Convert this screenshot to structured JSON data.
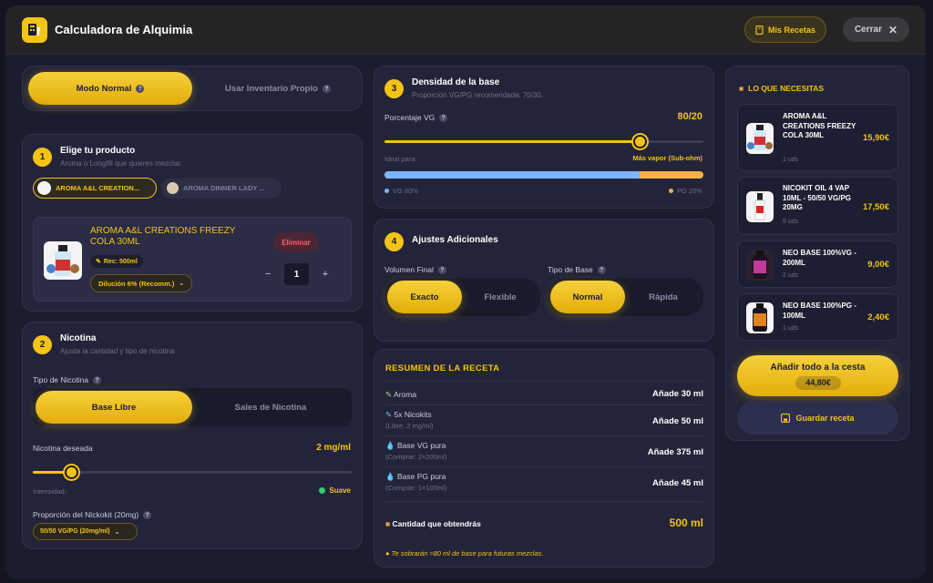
{
  "app": {
    "title": "Calculadora de Alquimia",
    "mis_recetas": "Mis Recetas",
    "cerrar": "Cerrar",
    "accent": "#f3c316"
  },
  "mode": {
    "normal": "Modo Normal",
    "inventory": "Usar Inventario Propio"
  },
  "product": {
    "step": "1",
    "title": "Elige tu producto",
    "subtitle": "Aroma o Longfill que quieres mezclar.",
    "chips": [
      "AROMA A&L CREATION...",
      "AROMA DINNER LADY ..."
    ],
    "selected_name": "AROMA A&L CREATIONS FREEZY COLA 30ML",
    "rec": "Rec: 500ml",
    "dilution": "Dilución 6% (Recomm.)",
    "remove": "Eliminar",
    "qty": "1",
    "minus": "−",
    "plus": "+"
  },
  "nicotine": {
    "step": "2",
    "title": "Nicotina",
    "subtitle": "Ajusta la cantidad y tipo de nicotina",
    "type_label": "Tipo de Nicotina",
    "base_libre": "Base Libre",
    "sales": "Sales de Nicotina",
    "desired_label": "Nicotina deseada",
    "desired_value": "2 mg/ml",
    "slider_fraction": 0.12,
    "intensity_label": "Intensidad:",
    "intensity_value": "Suave",
    "prop_label": "Proporción del Nickokit (20mg)",
    "prop_value": "50/50 VG/PG (20mg/ml)"
  },
  "density": {
    "step": "3",
    "title": "Densidad de la base",
    "subtitle": "Proporción VG/PG recomendada: 70/30.",
    "vg_label": "Porcentaje VG",
    "vg_value": "80/20",
    "vg_fraction": 0.8,
    "ideal_label": "Ideal para:",
    "ideal_value": "Más vapor (Sub-ohm)",
    "vg_legend": "VG 80%",
    "pg_legend": "PG 20%"
  },
  "adjust": {
    "step": "4",
    "title": "Ajustes Adicionales",
    "volume_label": "Volumen Final",
    "exact": "Exacto",
    "flexible": "Flexible",
    "base_label": "Tipo de Base",
    "normal": "Normal",
    "rapida": "Rápida"
  },
  "summary": {
    "title": "RESUMEN DE LA RECETA",
    "rows": [
      {
        "label": "Aroma",
        "sub": "",
        "value": "Añade 30 ml"
      },
      {
        "label": "5x Nicokits",
        "sub": "(Libre, 2 mg/ml)",
        "value": "Añade 50 ml"
      },
      {
        "label": "Base VG pura",
        "sub": "(Comprar: 2×200ml)",
        "value": "Añade 375 ml"
      },
      {
        "label": "Base PG pura",
        "sub": "(Comprar: 1×100ml)",
        "value": "Añade 45 ml"
      }
    ],
    "total_label": "Cantidad que obtendrás",
    "total_value": "500 ml",
    "note": "Te sobrarán ≈80 ml de base para futuras mezclas."
  },
  "cart": {
    "title": "LO QUE NECESITAS",
    "items": [
      {
        "name": "AROMA A&L CREATIONS FREEZY COLA 30ML",
        "qty": "1 uds",
        "price": "15,90€"
      },
      {
        "name": "NICOKIT OIL 4 VAP 10ML - 50/50 VG/PG 20MG",
        "qty": "5 uds",
        "price": "17,50€"
      },
      {
        "name": "NEO BASE 100%VG - 200ML",
        "qty": "2 uds",
        "price": "9,00€"
      },
      {
        "name": "NEO BASE 100%PG - 100ML",
        "qty": "1 uds",
        "price": "2,40€"
      }
    ],
    "add_all": "Añadir todo a la cesta",
    "total": "44,80€",
    "save": "Guardar receta"
  }
}
